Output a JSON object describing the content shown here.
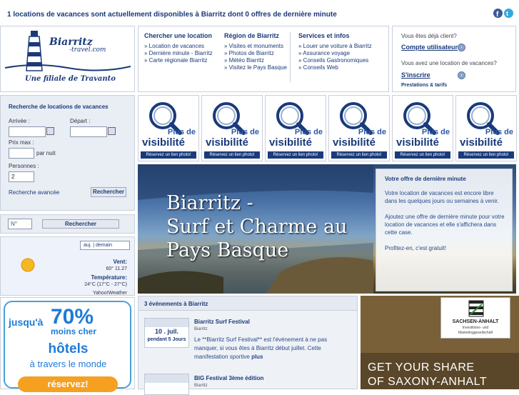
{
  "topbar": {
    "message": "1 locations de vacances sont actuellement disponibles à Biarritz dont 0 offres de dernière minute"
  },
  "logo": {
    "name": "Biarritz",
    "domain": "-travel.com",
    "tagline": "Une filiale de Travanto"
  },
  "nav": {
    "columns": [
      {
        "title": "Chercher une location",
        "items": [
          "Location de vacances",
          "Dernière minute - Biarritz",
          "Carte régionale Biarritz"
        ]
      },
      {
        "title": "Région de Biarritz",
        "items": [
          "Visites et monuments",
          "Photos de Biarritz",
          "Météo Biarritz",
          "Visitez le Pays Basque"
        ]
      },
      {
        "title": "Services et infos",
        "items": [
          "Louer une voiture à Biarritz",
          "Assurance voyage",
          "Conseils Gastronomiques",
          "Conseils Web"
        ]
      }
    ]
  },
  "account": {
    "q1": "Vous êtes déjà client?",
    "link1": "Compte utilisateur",
    "q2": "Vous avez une location de vacances?",
    "link2": "S'inscrire",
    "sub": "Prestations & tarifs"
  },
  "search": {
    "title": "Recherche de locations de vacances",
    "arrival_label": "Arrivée :",
    "departure_label": "Départ :",
    "price_label": "Prix max :",
    "per_night": "par nuit",
    "persons_label": "Personnes :",
    "persons_value": "2",
    "advanced": "Recherche avancée",
    "button": "Rechercher"
  },
  "number_search": {
    "placeholder": "N°",
    "button": "Rechercher"
  },
  "weather": {
    "tab_today": "auj.",
    "tab_tomorrow": "demain",
    "wind_label": "Vent:",
    "wind_value": "60° 11.27",
    "temp_label": "Température:",
    "temp_value": "24°C (17°C - 27°C)",
    "source": "Yahoo!Weather"
  },
  "promo": {
    "l1": "jusqu'à",
    "pct": "70%",
    "l2": "moins cher",
    "l3": "hôtels",
    "l4": "à travers le monde",
    "btn": "réservez!"
  },
  "visibility": {
    "l1": "Plus de",
    "l2": "visibilité",
    "l3": "Réservez un lien photo!"
  },
  "hero": {
    "title1": "Biarritz -",
    "title2": "Surf et Charme au",
    "title3": "Pays Basque"
  },
  "offer": {
    "title": "Votre offre de dernière minute",
    "p1": "Votre location de vacances est encore libre dans les quelques jours ou semaines à venir.",
    "p2": "Ajoutez une offre de dernière minute pour votre location de vacances et elle s'affichera dans cette case.",
    "p3": "Profitez-en, c'est gratuit!"
  },
  "events": {
    "header": "3 événements à Biarritz",
    "items": [
      {
        "title": "Biarritz Surf Festival",
        "place": "Biarritz",
        "date": "10 . juil.",
        "duration": "pendant 5 Jours",
        "desc": "Le **Biarritz Surf Festival** est l'événement à ne pas manquer, si vous êtes à Biarritz début juillet. Cette manifestation sportive",
        "more": "plus"
      },
      {
        "title": "BIG Festival 3ème édition",
        "place": "Biarritz"
      }
    ]
  },
  "ad": {
    "brand": "SACHSEN-ANHALT",
    "sub1": "Investitions- und",
    "sub2": "Marketinggesellschaft",
    "slogan1": "GET YOUR SHARE",
    "slogan2": "OF SAXONY-ANHALT"
  },
  "colors": {
    "brand": "#1a3a7a",
    "panel": "#e9edf4",
    "accent_blue": "#1e7bd8"
  }
}
